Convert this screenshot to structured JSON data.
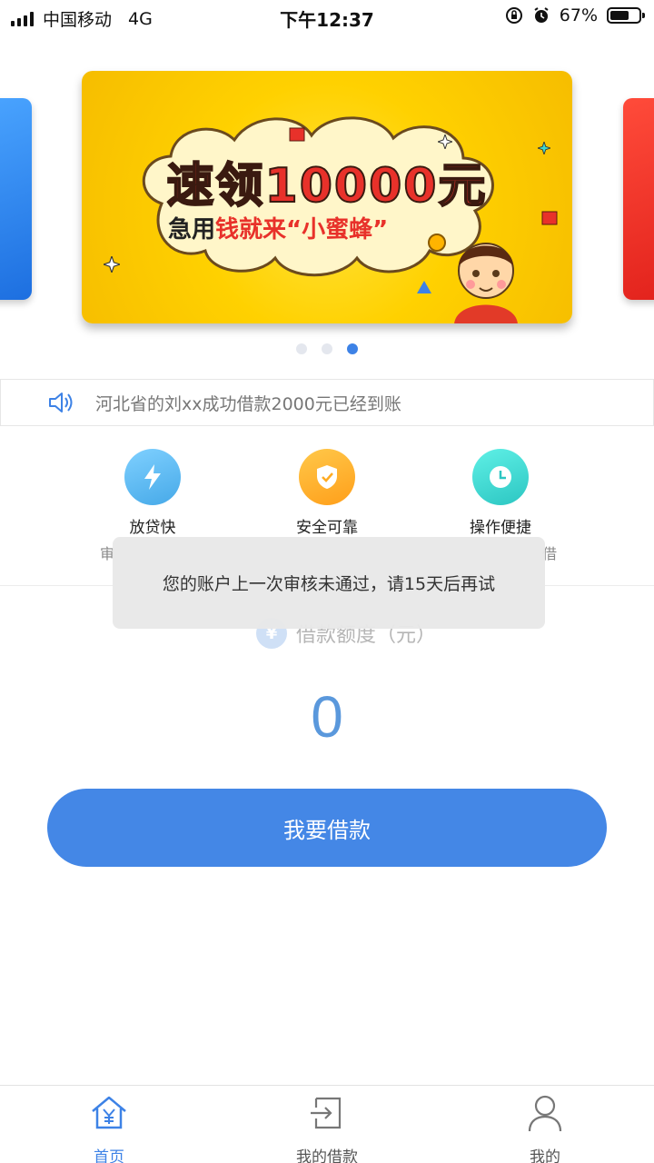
{
  "status_bar": {
    "carrier": "中国移动",
    "network": "4G",
    "time": "下午12:37",
    "battery": "67%",
    "battery_level": 0.67
  },
  "banner": {
    "title": "速领10000元",
    "subtitle_prefix": "急用",
    "subtitle_highlight": "钱就来“小蜜蜂”",
    "active_index": 2,
    "count": 3
  },
  "notice": {
    "icon": "speaker-icon",
    "text": "河北省的刘xx成功借款2000元已经到账"
  },
  "features": [
    {
      "label": "放贷快",
      "icon": "lightning-icon",
      "color": "#5bb9f0"
    },
    {
      "label": "安全可靠",
      "icon": "shield-check-icon",
      "color": "#ffb52e"
    },
    {
      "label": "操作便捷",
      "icon": "clock-icon",
      "color": "#3fd6cf"
    }
  ],
  "feature_subs": {
    "left": "审",
    "right": "借"
  },
  "credit": {
    "icon": "yen-icon",
    "icon_text": "¥",
    "label": "借款额度（元）",
    "amount": "0"
  },
  "borrow_button": "我要借款",
  "toast": "您的账户上一次审核未通过，请15天后再试",
  "tabs": [
    {
      "label": "首页",
      "icon": "home-yen-icon",
      "active": true
    },
    {
      "label": "我的借款",
      "icon": "loan-export-icon",
      "active": false
    },
    {
      "label": "我的",
      "icon": "user-icon",
      "active": false
    }
  ]
}
